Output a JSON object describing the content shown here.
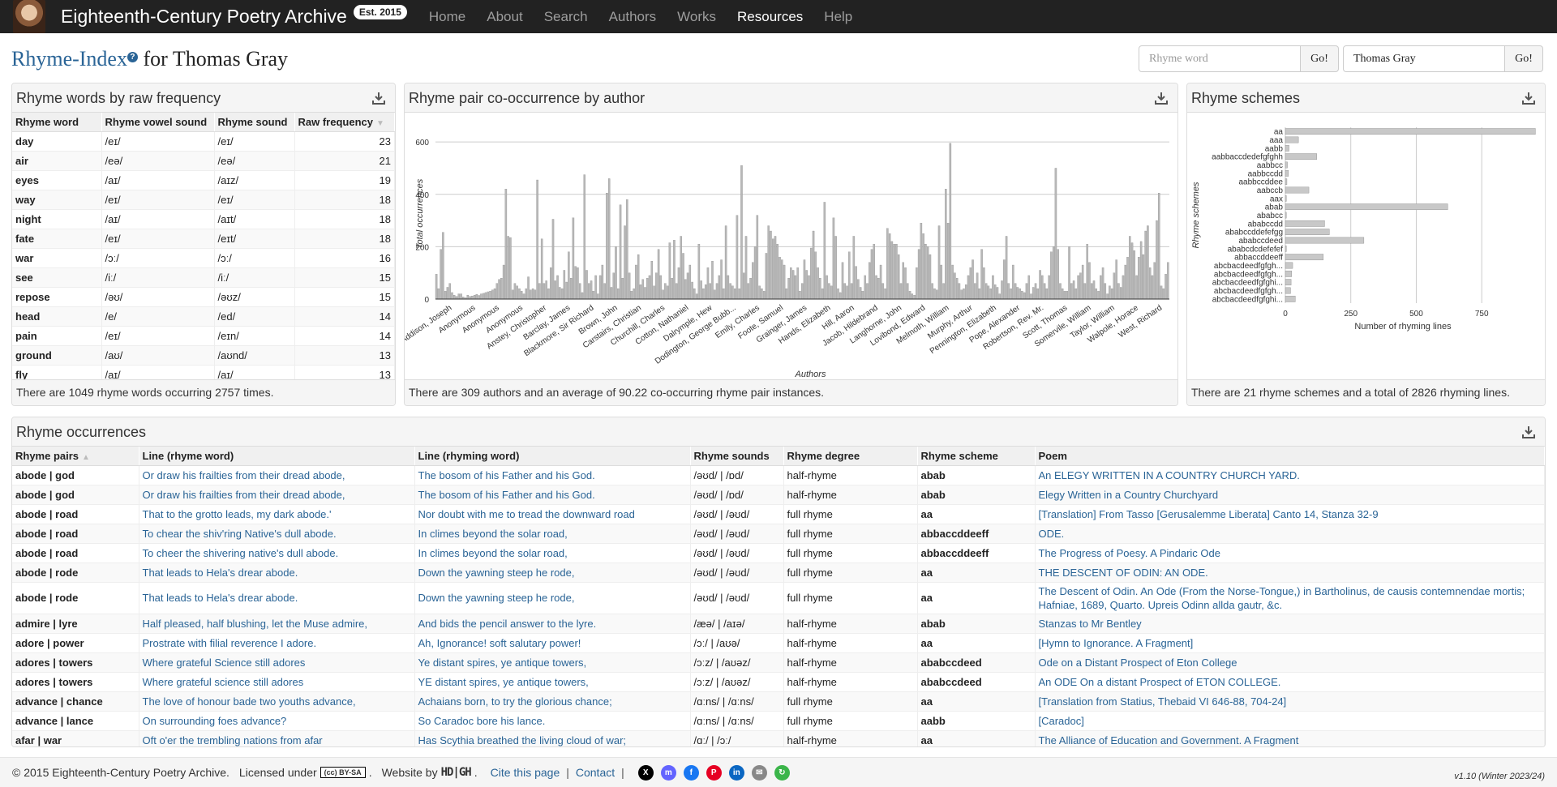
{
  "navbar": {
    "brand": "Eighteenth-Century Poetry Archive",
    "badge": "Est. 2015",
    "items": [
      "Home",
      "About",
      "Search",
      "Authors",
      "Works",
      "Resources",
      "Help"
    ],
    "active": "Resources"
  },
  "title": {
    "link": "Rhyme-Index",
    "help": "?",
    "rest": " for Thomas Gray"
  },
  "search": {
    "rhyme_placeholder": "Rhyme word",
    "go": "Go!",
    "author_value": "Thomas Gray"
  },
  "freq": {
    "title": "Rhyme words by raw frequency",
    "columns": [
      "Rhyme word",
      "Rhyme vowel sound",
      "Rhyme sound",
      "Raw frequency"
    ],
    "rows": [
      [
        "day",
        "/eɪ/",
        "/eɪ/",
        "23"
      ],
      [
        "air",
        "/eə/",
        "/eə/",
        "21"
      ],
      [
        "eyes",
        "/aɪ/",
        "/aɪz/",
        "19"
      ],
      [
        "way",
        "/eɪ/",
        "/eɪ/",
        "18"
      ],
      [
        "night",
        "/aɪ/",
        "/aɪt/",
        "18"
      ],
      [
        "fate",
        "/eɪ/",
        "/eɪt/",
        "18"
      ],
      [
        "war",
        "/ɔː/",
        "/ɔː/",
        "16"
      ],
      [
        "see",
        "/iː/",
        "/iː/",
        "15"
      ],
      [
        "repose",
        "/əʊ/",
        "/əʊz/",
        "15"
      ],
      [
        "head",
        "/e/",
        "/ed/",
        "14"
      ],
      [
        "pain",
        "/eɪ/",
        "/eɪn/",
        "14"
      ],
      [
        "ground",
        "/aʊ/",
        "/aʊnd/",
        "13"
      ],
      [
        "fly",
        "/aɪ/",
        "/aɪ/",
        "13"
      ]
    ],
    "footer": "There are 1049 rhyme words occurring 2757 times."
  },
  "pair": {
    "title": "Rhyme pair co-occurrence by author",
    "footer": "There are 309 authors and an average of 90.22 co-occurring rhyme pair instances."
  },
  "schemes": {
    "title": "Rhyme schemes",
    "footer": "There are 21 rhyme schemes and a total of 2826 rhyming lines."
  },
  "chart_data": [
    {
      "type": "bar",
      "title": "Rhyme pair co-occurrence by author",
      "xlabel": "Authors",
      "ylabel": "Total occurrences",
      "ylim": [
        0,
        650
      ],
      "yticks": [
        0,
        200,
        400,
        600
      ],
      "grid": true,
      "tick_labels": [
        "Addison, Joseph",
        "Anonymous",
        "Anonymous",
        "Anonymous",
        "Anstey, Christopher",
        "Barclay, James",
        "Blackmore, Sir Richard",
        "Brown, John",
        "Carstairs, Christian",
        "Churchill, Charles",
        "Cotton, Nathaniel",
        "Dalrymple, Hew",
        "Dodington, George Bubb...",
        "Emily, Charles",
        "Foote, Samuel",
        "Grainger, James",
        "Hands, Elizabeth",
        "Hill, Aaron",
        "Jacob, Hildebrand",
        "Langhorne, John",
        "Lovibond, Edward",
        "Melmoth, William",
        "Murphy, Arthur",
        "Pennington, Elizabeth",
        "Pope, Alexander",
        "Robertson, Rev. Mr.",
        "Scott, Thomas",
        "Somervile, William",
        "Taylor, William",
        "Walpole, Horace",
        "West, Richard"
      ],
      "values": [
        95,
        40,
        190,
        255,
        30,
        45,
        60,
        25,
        15,
        10,
        20,
        20,
        8,
        5,
        15,
        10,
        12,
        15,
        18,
        14,
        20,
        22,
        25,
        28,
        30,
        35,
        40,
        60,
        75,
        80,
        130,
        420,
        240,
        235,
        35,
        60,
        50,
        40,
        30,
        20,
        40,
        85,
        35,
        40,
        35,
        455,
        60,
        230,
        60,
        70,
        40,
        120,
        305,
        70,
        90,
        45,
        40,
        110,
        65,
        180,
        80,
        310,
        125,
        120,
        60,
        25,
        475,
        110,
        60,
        70,
        30,
        90,
        20,
        90,
        130,
        60,
        405,
        460,
        45,
        100,
        200,
        40,
        360,
        80,
        280,
        380,
        100,
        30,
        40,
        130,
        170,
        55,
        75,
        45,
        80,
        90,
        145,
        50,
        100,
        190,
        90,
        35,
        60,
        50,
        215,
        80,
        225,
        60,
        120,
        240,
        175,
        75,
        100,
        130,
        65,
        40,
        20,
        210,
        70,
        40,
        55,
        120,
        60,
        145,
        35,
        60,
        90,
        150,
        40,
        280,
        90,
        60,
        50,
        40,
        320,
        40,
        510,
        100,
        240,
        60,
        80,
        140,
        200,
        320,
        50,
        40,
        30,
        175,
        280,
        260,
        230,
        240,
        210,
        160,
        150,
        130,
        40,
        80,
        120,
        110,
        90,
        120,
        30,
        60,
        150,
        110,
        90,
        195,
        260,
        180,
        120,
        80,
        40,
        370,
        90,
        60,
        50,
        310,
        240,
        40,
        25,
        140,
        60,
        50,
        180,
        60,
        240,
        125,
        75,
        45,
        30,
        90,
        60,
        140,
        190,
        210,
        90,
        80,
        130,
        60,
        40,
        270,
        250,
        220,
        210,
        210,
        170,
        60,
        140,
        120,
        60,
        30,
        20,
        15,
        120,
        190,
        290,
        250,
        210,
        200,
        170,
        60,
        40,
        35,
        280,
        130,
        60,
        420,
        290,
        595,
        130,
        100,
        80,
        60,
        35,
        40,
        55,
        90,
        120,
        150,
        60,
        100,
        40,
        190,
        120,
        60,
        50,
        40,
        90,
        55,
        45,
        20,
        70,
        150,
        240,
        60,
        40,
        130,
        60,
        45,
        40,
        30,
        25,
        60,
        90,
        20,
        45,
        60,
        40,
        110,
        90,
        60,
        40,
        90,
        180,
        200,
        500,
        190,
        60,
        40,
        30,
        30,
        200,
        60,
        70,
        40,
        90,
        100,
        130,
        60,
        210,
        140,
        60,
        70,
        40,
        30,
        90,
        120,
        60,
        20,
        50,
        40,
        100,
        150,
        60,
        45,
        90,
        130,
        160,
        240,
        215,
        185,
        90,
        160,
        220,
        170,
        260,
        280,
        120,
        90,
        140,
        300,
        405,
        50,
        40,
        95,
        140
      ]
    },
    {
      "type": "bar",
      "orientation": "horizontal",
      "title": "Rhyme schemes",
      "xlabel": "Number of rhyming lines",
      "ylabel": "Rhyme schemes",
      "xlim": [
        0,
        960
      ],
      "xticks": [
        0,
        250,
        500,
        750
      ],
      "categories": [
        "aa",
        "aaa",
        "aabb",
        "aabbaccdedefgfghh",
        "aabbcc",
        "aabbccdd",
        "aabbccddee",
        "aabccb",
        "aax",
        "abab",
        "ababcc",
        "ababccdd",
        "ababccddefefgg",
        "ababccdeed",
        "ababcdcdefefef",
        "abbaccddeeff",
        "abcbacdeedfgfgh...",
        "abcbacdeedfgfgh...",
        "abcbacdeedfgfghi...",
        "abcbacdeedfgfgh...",
        "abcbacdeedfgfghi..."
      ],
      "values": [
        955,
        50,
        14,
        120,
        8,
        12,
        6,
        90,
        4,
        620,
        4,
        150,
        168,
        300,
        4,
        145,
        28,
        24,
        22,
        20,
        38
      ]
    }
  ],
  "occ": {
    "title": "Rhyme occurrences",
    "columns": [
      "Rhyme pairs",
      "Line (rhyme word)",
      "Line (rhyming word)",
      "Rhyme sounds",
      "Rhyme degree",
      "Rhyme scheme",
      "Poem"
    ],
    "rows": [
      [
        "abode | god",
        "Or draw his frailties from their dread abode,",
        "The bosom of his Father and his God.",
        "/əʊd/ | /ɒd/",
        "half-rhyme",
        "abab",
        "An ELEGY WRITTEN IN A COUNTRY CHURCH YARD."
      ],
      [
        "abode | god",
        "Or draw his frailties from their dread abode,",
        "The bosom of his Father and his God.",
        "/əʊd/ | /ɒd/",
        "half-rhyme",
        "abab",
        "Elegy Written in a Country Churchyard"
      ],
      [
        "abode | road",
        "That to the grotto leads, my dark abode.'",
        "Nor doubt with me to tread the downward road",
        "/əʊd/ | /əʊd/",
        "full rhyme",
        "aa",
        "[Translation] From Tasso [Gerusalemme Liberata] Canto 14, Stanza 32-9"
      ],
      [
        "abode | road",
        "To chear the shiv'ring Native's dull abode.",
        "In climes beyond the solar road,",
        "/əʊd/ | /əʊd/",
        "full rhyme",
        "abbaccddeeff",
        "ODE."
      ],
      [
        "abode | road",
        "To cheer the shivering native's dull abode.",
        "In climes beyond the solar road,",
        "/əʊd/ | /əʊd/",
        "full rhyme",
        "abbaccddeeff",
        "The Progress of Poesy. A Pindaric Ode"
      ],
      [
        "abode | rode",
        "That leads to Hela's drear abode.",
        "Down the yawning steep he rode,",
        "/əʊd/ | /əʊd/",
        "full rhyme",
        "aa",
        "THE DESCENT OF ODIN: AN ODE."
      ],
      [
        "abode | rode",
        "That leads to Hela's drear abode.",
        "Down the yawning steep he rode,",
        "/əʊd/ | /əʊd/",
        "full rhyme",
        "aa",
        "The Descent of Odin. An Ode (From the Norse-Tongue,) in Bartholinus, de causis contemnendae mortis; Hafniae, 1689, Quarto. Upreis Odinn allda gautr, &c."
      ],
      [
        "admire | lyre",
        "Half pleased, half blushing, let the Muse admire,",
        "And bids the pencil answer to the lyre.",
        "/æə/ | /aɪə/",
        "half-rhyme",
        "abab",
        "Stanzas to Mr Bentley"
      ],
      [
        "adore | power",
        "Prostrate with filial reverence I adore.",
        "Ah, Ignorance! soft salutary power!",
        "/ɔː/ | /aʊə/",
        "half-rhyme",
        "aa",
        "[Hymn to Ignorance. A Fragment]"
      ],
      [
        "adores | towers",
        "Where grateful Science still adores",
        "Ye distant spires, ye antique towers,",
        "/ɔːz/ | /aʊəz/",
        "half-rhyme",
        "ababccdeed",
        "Ode on a Distant Prospect of Eton College"
      ],
      [
        "adores | towers",
        "Where grateful science still adores",
        "YE distant spires, ye antique towers,",
        "/ɔːz/ | /aʊəz/",
        "half-rhyme",
        "ababccdeed",
        "An ODE On a distant Prospect of ETON COLLEGE."
      ],
      [
        "advance | chance",
        "The love of honour bade two youths advance,",
        "Achaians born, to try the glorious chance;",
        "/ɑːns/ | /ɑːns/",
        "full rhyme",
        "aa",
        "[Translation from Statius, Thebaid VI 646-88, 704-24]"
      ],
      [
        "advance | lance",
        "On surrounding foes advance?",
        "So Caradoc bore his lance.",
        "/ɑːns/ | /ɑːns/",
        "full rhyme",
        "aabb",
        "[Caradoc]"
      ],
      [
        "afar | war",
        "Oft o'er the trembling nations from afar",
        "Has Scythia breathed the living cloud of war;",
        "/ɑː/ | /ɔː/",
        "half-rhyme",
        "aa",
        "The Alliance of Education and Government. A Fragment"
      ]
    ]
  },
  "footer": {
    "copyright": "© 2015 Eighteenth-Century Poetry Archive.",
    "licensed": "Licensed under",
    "cc": "(cc) BY-SA",
    "website": "Website by",
    "hdh": "HD|GH",
    "cite": "Cite this page",
    "sep": "|",
    "contact": "Contact",
    "version": "v1.10 (Winter 2023/24)"
  },
  "icons": [
    "download-icon",
    "help-icon",
    "x-icon",
    "mastodon-icon",
    "facebook-icon",
    "pinterest-icon",
    "linkedin-icon",
    "email-icon",
    "share-icon"
  ]
}
